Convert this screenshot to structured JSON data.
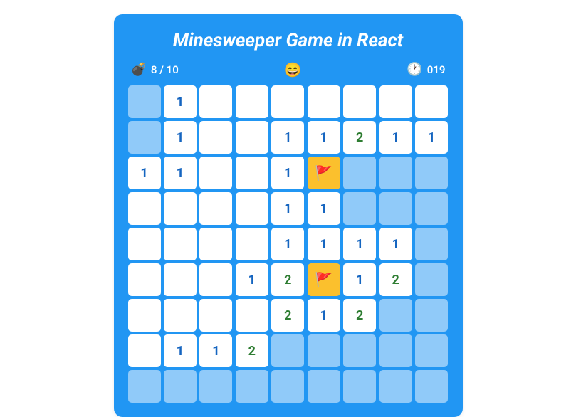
{
  "title": "Minesweeper Game in React",
  "status": {
    "bomb_icon": "💣",
    "flags_used": 8,
    "total_mines": 10,
    "flags_text": "8 / 10",
    "face_icon": "😄",
    "clock_icon": "🕐",
    "time_text": "019",
    "time_seconds": 19
  },
  "grid": {
    "cols": 9,
    "rows": 9,
    "flag_icon": "🚩",
    "cells": [
      [
        "-",
        "1r",
        "r",
        "r",
        "r",
        "r",
        "r",
        "r",
        "r"
      ],
      [
        "-",
        "1r",
        "r",
        "r",
        "1r",
        "1r",
        "2r",
        "1r",
        "1r"
      ],
      [
        "1r",
        "1r",
        "r",
        "r",
        "1r",
        "F",
        "-",
        "-",
        "-"
      ],
      [
        "r",
        "r",
        "r",
        "r",
        "1r",
        "1r",
        "-",
        "-",
        "-"
      ],
      [
        "r",
        "r",
        "r",
        "r",
        "1r",
        "1r",
        "1r",
        "1r",
        "-"
      ],
      [
        "r",
        "r",
        "r",
        "1r",
        "2r",
        "F",
        "1r",
        "2r",
        "-"
      ],
      [
        "r",
        "r",
        "r",
        "r",
        "2r",
        "1r",
        "2r",
        "-",
        "-"
      ],
      [
        "r",
        "1r",
        "1r",
        "2r",
        "-",
        "-",
        "-",
        "-",
        "-"
      ],
      [
        "-",
        "-",
        "-",
        "-",
        "-",
        "-",
        "-",
        "-",
        "-"
      ]
    ]
  }
}
